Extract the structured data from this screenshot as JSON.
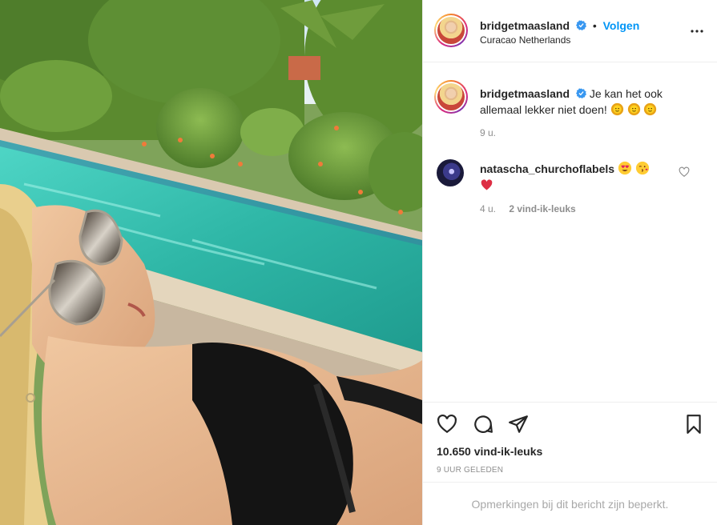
{
  "header": {
    "username": "bridgetmaasland",
    "separator": "•",
    "follow_label": "Volgen",
    "location": "Curacao Netherlands"
  },
  "caption": {
    "username": "bridgetmaasland",
    "text": "Je kan het ook allemaal lekker niet doen!",
    "emoji": [
      "sun",
      "sun",
      "sun"
    ],
    "time": "9 u."
  },
  "comment": {
    "username": "natascha_churchoflabels",
    "emoji": [
      "heart-eyes",
      "kissing-face",
      "red-heart"
    ],
    "time": "4 u.",
    "likes": "2 vind-ik-leuks"
  },
  "actions": {
    "likes": "10.650 vind-ik-leuks",
    "posted": "9 UUR GELEDEN"
  },
  "footer": {
    "limited_text": "Opmerkingen bij dit bericht zijn beperkt."
  },
  "colors": {
    "accent_blue": "#0095f6",
    "secondary_text": "#8e8e8e",
    "pool": "#35c4b2",
    "heart_red": "#ed4956"
  },
  "icons": [
    "more-icon",
    "heart-icon",
    "comment-icon",
    "share-icon",
    "bookmark-icon",
    "verified-icon"
  ]
}
